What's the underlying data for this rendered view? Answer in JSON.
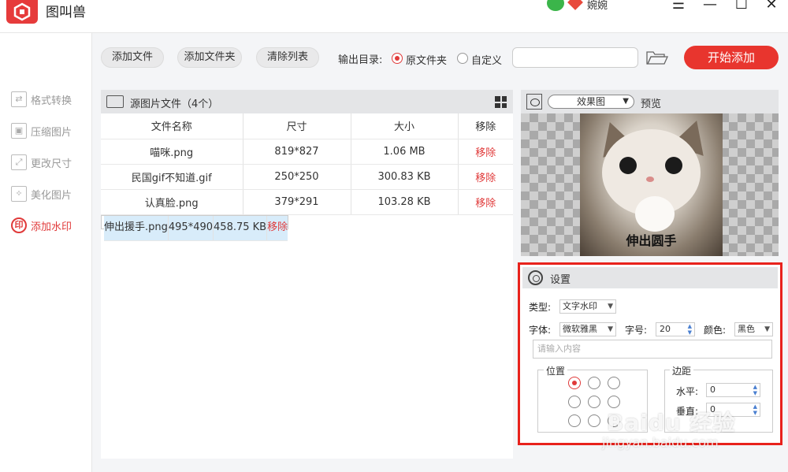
{
  "app": {
    "title": "图叫兽",
    "username": "婉婉",
    "window_controls": [
      "menu-icon",
      "minimize-icon",
      "maximize-icon",
      "close-icon"
    ]
  },
  "sidebar": {
    "items": [
      {
        "label": "格式转换",
        "icon": "format-convert-icon",
        "active": false
      },
      {
        "label": "压缩图片",
        "icon": "compress-icon",
        "active": false
      },
      {
        "label": "更改尺寸",
        "icon": "resize-icon",
        "active": false
      },
      {
        "label": "美化图片",
        "icon": "beautify-icon",
        "active": false
      },
      {
        "label": "添加水印",
        "icon": "watermark-icon",
        "icon_glyph": "印",
        "active": true
      }
    ]
  },
  "toolbar": {
    "add_file": "添加文件",
    "add_folder": "添加文件夹",
    "clear_list": "清除列表",
    "output_dir_label": "输出目录:",
    "radio_original": "原文件夹",
    "radio_custom": "自定义",
    "output_path": "",
    "start_button": "开始添加",
    "accent_color": "#e8352e"
  },
  "file_list": {
    "title": "源图片文件（4个）",
    "columns": [
      "文件名称",
      "尺寸",
      "大小",
      "移除"
    ],
    "rows": [
      {
        "name": "喵咪.png",
        "size": "819*827",
        "filesize": "1.06 MB",
        "action": "移除",
        "selected": false
      },
      {
        "name": "民国gif不知道.gif",
        "size": "250*250",
        "filesize": "300.83 KB",
        "action": "移除",
        "selected": false
      },
      {
        "name": "认真脸.png",
        "size": "379*291",
        "filesize": "103.28 KB",
        "action": "移除",
        "selected": false
      },
      {
        "name": "伸出援手.png",
        "size": "495*490",
        "filesize": "458.75 KB",
        "action": "移除",
        "selected": true
      }
    ]
  },
  "preview": {
    "mode_select": "效果图",
    "label": "预览",
    "watermark_text": "伸出圆手"
  },
  "settings": {
    "title": "设置",
    "type_label": "类型:",
    "type_value": "文字水印",
    "font_label": "字体:",
    "font_value": "微软雅黑",
    "size_label": "字号:",
    "size_value": "20",
    "color_label": "颜色:",
    "color_value": "黑色",
    "content_placeholder": "请输入内容",
    "position_legend": "位置",
    "position_selected": "top-left",
    "margin_legend": "边距",
    "horizontal_label": "水平:",
    "horizontal_value": "0",
    "vertical_label": "垂直:",
    "vertical_value": "0",
    "highlight_color": "#e8221c"
  },
  "overlay": {
    "baidu_logo": "Baidu 经验",
    "baidu_url": "jingyan.baidu.com"
  }
}
